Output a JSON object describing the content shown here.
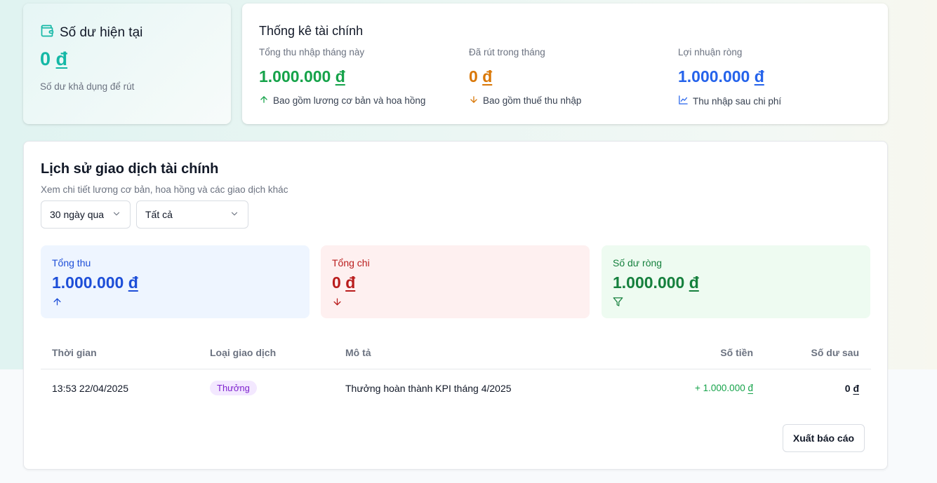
{
  "balance": {
    "title": "Số dư hiện tại",
    "amount_number": "0",
    "currency": "đ",
    "subtitle": "Số dư khả dụng để rút",
    "icon": "wallet-icon"
  },
  "stats": {
    "title": "Thống kê tài chính",
    "income": {
      "label": "Tổng thu nhập tháng này",
      "amount_number": "1.000.000",
      "currency": "đ",
      "note": "Bao gồm lương cơ bản và hoa hồng",
      "icon": "arrow-up-icon",
      "color": "#16a34a"
    },
    "withdrawn": {
      "label": "Đã rút trong tháng",
      "amount_number": "0",
      "currency": "đ",
      "note": "Bao gồm thuế thu nhập",
      "icon": "arrow-down-icon",
      "color": "#d97706"
    },
    "net_profit": {
      "label": "Lợi nhuận ròng",
      "amount_number": "1.000.000",
      "currency": "đ",
      "note": "Thu nhập sau chi phí",
      "icon": "line-chart-icon",
      "color": "#2563eb"
    }
  },
  "history": {
    "title": "Lịch sử giao dịch tài chính",
    "subtitle": "Xem chi tiết lương cơ bản, hoa hồng và các giao dịch khác",
    "filters": {
      "period": "30 ngày qua",
      "type": "Tất cả"
    },
    "summary": {
      "total_in": {
        "label": "Tổng thu",
        "amount_number": "1.000.000",
        "currency": "đ",
        "icon": "arrow-up-icon",
        "color": "#1d4ed8"
      },
      "total_out": {
        "label": "Tổng chi",
        "amount_number": "0",
        "currency": "đ",
        "icon": "arrow-down-icon",
        "color": "#b91c1c"
      },
      "net_balance": {
        "label": "Số dư ròng",
        "amount_number": "1.000.000",
        "currency": "đ",
        "icon": "filter-icon",
        "color": "#15803d"
      }
    },
    "columns": [
      "Thời gian",
      "Loại giao dịch",
      "Mô tả",
      "Số tiền",
      "Số dư sau"
    ],
    "rows": [
      {
        "time": "13:53 22/04/2025",
        "type": "Thưởng",
        "description": "Thưởng hoàn thành KPI tháng 4/2025",
        "amount_prefix": "+ 1.000.000",
        "amount_currency": "đ",
        "balance_after_number": "0",
        "balance_after_currency": "đ"
      }
    ],
    "export_label": "Xuất báo cáo"
  }
}
